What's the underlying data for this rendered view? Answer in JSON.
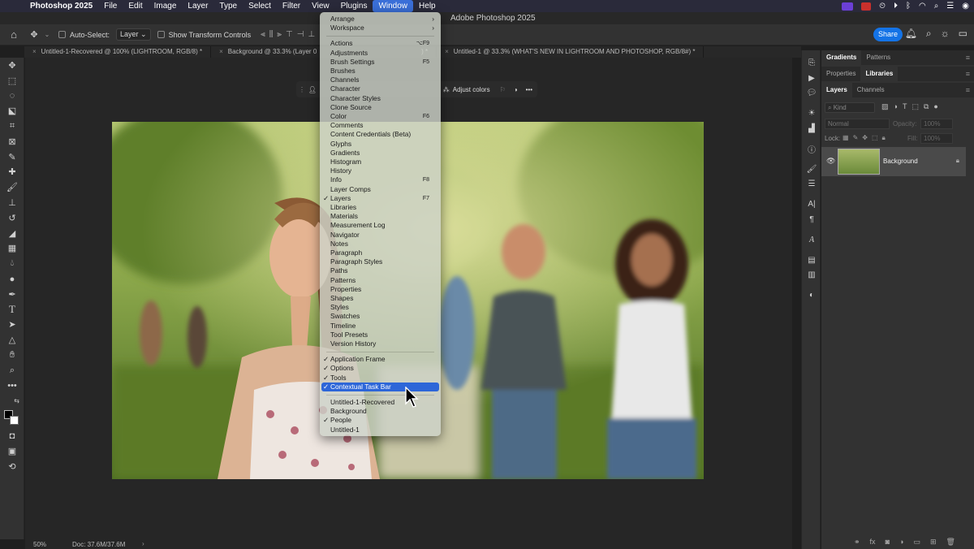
{
  "menubar": {
    "app_name": "Photoshop 2025",
    "items": [
      "File",
      "Edit",
      "Image",
      "Layer",
      "Type",
      "Select",
      "Filter",
      "View",
      "Plugins",
      "Window",
      "Help"
    ],
    "active_item": "Window"
  },
  "window_title": "Adobe Photoshop 2025",
  "options_bar": {
    "auto_select_label": "Auto-Select:",
    "auto_select_value": "Layer",
    "transform_label": "Show Transform Controls",
    "share_label": "Share"
  },
  "tabs": [
    "Untitled-1-Recovered @ 100% (LIGHTROOM, RGB/8) *",
    "Background @ 33.3% (Layer 0",
    "Untitled-1 @ 33.3% (WHAT'S NEW IN LIGHTROOM AND PHOTOSHOP, RGB/8#) *"
  ],
  "tab_close_glyph": "×",
  "tab_fragment": ") *",
  "ctx_taskbar": {
    "adjust_label": "Adjust colors"
  },
  "window_menu": {
    "groups": [
      [
        {
          "label": "Arrange",
          "submenu": true
        },
        {
          "label": "Workspace",
          "submenu": true
        }
      ],
      [
        {
          "label": "Actions",
          "shortcut": "⌥F9"
        },
        {
          "label": "Adjustments"
        },
        {
          "label": "Brush Settings",
          "shortcut": "F5"
        },
        {
          "label": "Brushes"
        },
        {
          "label": "Channels"
        },
        {
          "label": "Character"
        },
        {
          "label": "Character Styles"
        },
        {
          "label": "Clone Source"
        },
        {
          "label": "Color",
          "shortcut": "F6"
        },
        {
          "label": "Comments"
        },
        {
          "label": "Content Credentials (Beta)"
        },
        {
          "label": "Glyphs"
        },
        {
          "label": "Gradients"
        },
        {
          "label": "Histogram"
        },
        {
          "label": "History"
        },
        {
          "label": "Info",
          "shortcut": "F8"
        },
        {
          "label": "Layer Comps"
        },
        {
          "label": "Layers",
          "shortcut": "F7",
          "checked": true
        },
        {
          "label": "Libraries"
        },
        {
          "label": "Materials"
        },
        {
          "label": "Measurement Log"
        },
        {
          "label": "Navigator"
        },
        {
          "label": "Notes"
        },
        {
          "label": "Paragraph"
        },
        {
          "label": "Paragraph Styles"
        },
        {
          "label": "Paths"
        },
        {
          "label": "Patterns"
        },
        {
          "label": "Properties"
        },
        {
          "label": "Shapes"
        },
        {
          "label": "Styles"
        },
        {
          "label": "Swatches"
        },
        {
          "label": "Timeline"
        },
        {
          "label": "Tool Presets"
        },
        {
          "label": "Version History"
        }
      ],
      [
        {
          "label": "Application Frame",
          "checked": true
        },
        {
          "label": "Options",
          "checked": true
        },
        {
          "label": "Tools",
          "checked": true
        },
        {
          "label": "Contextual Task Bar",
          "checked": true,
          "highlighted": true
        }
      ],
      [
        {
          "label": "Untitled-1-Recovered"
        },
        {
          "label": "Background"
        },
        {
          "label": "People",
          "checked": true
        },
        {
          "label": "Untitled-1"
        }
      ]
    ]
  },
  "panels": {
    "group1_tabs": [
      "Gradients",
      "Patterns"
    ],
    "group2_tabs": [
      "Properties",
      "Libraries"
    ],
    "group3_tabs": [
      "Layers",
      "Channels"
    ],
    "kind_placeholder": "Kind",
    "blend_mode": "Normal",
    "opacity_label": "Opacity:",
    "opacity_value": "100%",
    "lock_label": "Lock:",
    "fill_label": "Fill:",
    "fill_value": "100%",
    "layer_name": "Background"
  },
  "status": {
    "zoom": "50%",
    "doc": "Doc: 37.6M/37.6M"
  }
}
